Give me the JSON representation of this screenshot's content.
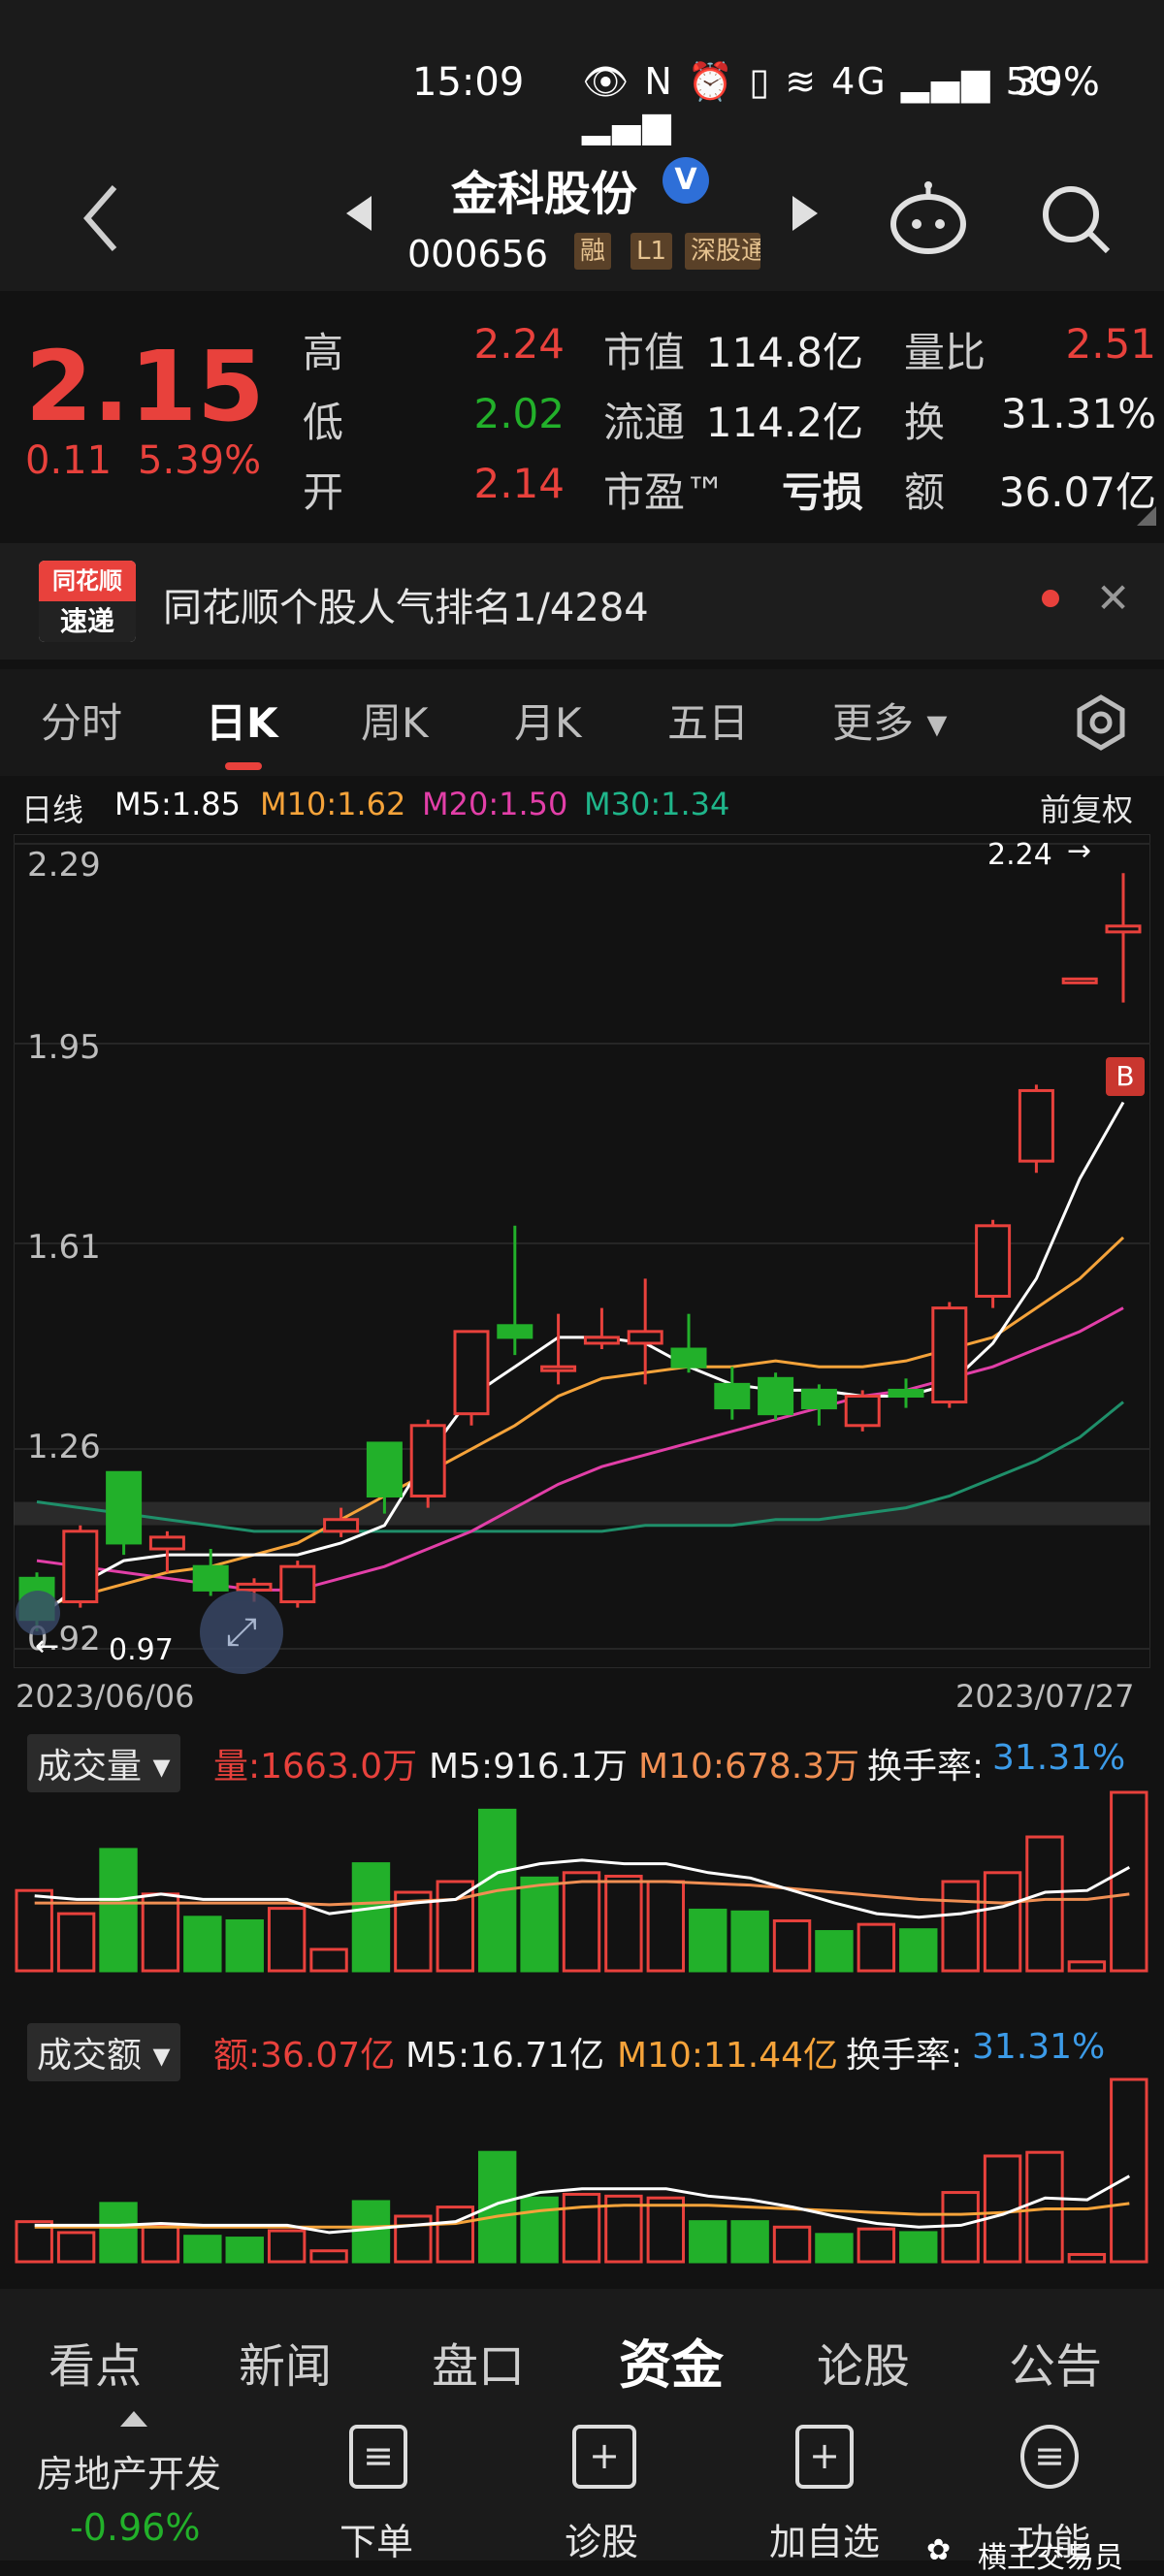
{
  "status_bar": {
    "time": "15:09",
    "icons": "👁 N ⏰ ▯ ≋ 4G ▂▄▆ 5G ▂▄▆",
    "battery": "39%"
  },
  "header": {
    "stock_name": "金科股份",
    "verified": "V",
    "code": "000656",
    "tags": [
      "融",
      "L1",
      "深股通"
    ]
  },
  "quote": {
    "price": "2.15",
    "change": "0.11",
    "change_pct": "5.39%",
    "high_label": "高",
    "high": "2.24",
    "low_label": "低",
    "low": "2.02",
    "open_label": "开",
    "open": "2.14",
    "mcap_label": "市值",
    "mcap": "114.8亿",
    "float_label": "流通",
    "float": "114.2亿",
    "pe_label": "市盈™",
    "pe": "亏损",
    "vr_label": "量比",
    "vr": "2.51",
    "turn_label": "换",
    "turn": "31.31%",
    "amt_label": "额",
    "amt": "36.07亿"
  },
  "banner": {
    "logo_top": "同花顺",
    "logo_bottom": "速递",
    "text": "同花顺个股人气排名1/4284"
  },
  "tabs": [
    "分时",
    "日K",
    "周K",
    "月K",
    "五日",
    "更多 ▾"
  ],
  "kline": {
    "legend_label": "日线",
    "m5": "M5:1.85",
    "m10": "M10:1.62",
    "m20": "M20:1.50",
    "m30": "M30:1.34",
    "adjust": "前复权",
    "max_marker": "2.24",
    "min_marker": "0.97",
    "buy_marker": "B",
    "y_ticks": [
      "2.29",
      "1.95",
      "1.61",
      "1.26",
      "0.92"
    ],
    "start_date": "2023/06/06",
    "end_date": "2023/07/27"
  },
  "volume_panel": {
    "title": "成交量",
    "value": "量:1663.0万",
    "m5": "M5:916.1万",
    "m10": "M10:678.3万",
    "turnover_label": "换手率:",
    "turnover": "31.31%"
  },
  "amount_panel": {
    "title": "成交额",
    "value": "额:36.07亿",
    "m5": "M5:16.71亿",
    "m10": "M10:11.44亿",
    "turnover_label": "换手率:",
    "turnover": "31.31%"
  },
  "colors": {
    "up": "#e8413c",
    "down": "#22b02a",
    "m5": "#ffffff",
    "m10": "#f5a33a",
    "m20": "#e23fa8",
    "m30": "#1f8f6a",
    "turnover": "#3c9be8"
  },
  "chart_data": [
    {
      "type": "candlestick",
      "title": "日线",
      "x_start": "2023/06/06",
      "x_end": "2023/07/27",
      "ylim": [
        0.92,
        2.29
      ],
      "candles": [
        {
          "o": 1.04,
          "c": 0.97,
          "h": 1.05,
          "l": 0.95
        },
        {
          "o": 1.0,
          "c": 1.12,
          "h": 1.13,
          "l": 0.99
        },
        {
          "o": 1.22,
          "c": 1.1,
          "h": 1.22,
          "l": 1.08
        },
        {
          "o": 1.09,
          "c": 1.11,
          "h": 1.12,
          "l": 1.05
        },
        {
          "o": 1.06,
          "c": 1.02,
          "h": 1.09,
          "l": 1.01
        },
        {
          "o": 1.02,
          "c": 1.03,
          "h": 1.04,
          "l": 1.0
        },
        {
          "o": 1.0,
          "c": 1.06,
          "h": 1.07,
          "l": 0.99
        },
        {
          "o": 1.12,
          "c": 1.14,
          "h": 1.16,
          "l": 1.11
        },
        {
          "o": 1.27,
          "c": 1.18,
          "h": 1.27,
          "l": 1.15
        },
        {
          "o": 1.18,
          "c": 1.3,
          "h": 1.31,
          "l": 1.16
        },
        {
          "o": 1.32,
          "c": 1.46,
          "h": 1.46,
          "l": 1.3
        },
        {
          "o": 1.47,
          "c": 1.45,
          "h": 1.64,
          "l": 1.42
        },
        {
          "o": 1.4,
          "c": 1.4,
          "h": 1.49,
          "l": 1.37
        },
        {
          "o": 1.44,
          "c": 1.45,
          "h": 1.5,
          "l": 1.43
        },
        {
          "o": 1.44,
          "c": 1.46,
          "h": 1.55,
          "l": 1.37
        },
        {
          "o": 1.43,
          "c": 1.4,
          "h": 1.49,
          "l": 1.39
        },
        {
          "o": 1.37,
          "c": 1.33,
          "h": 1.4,
          "l": 1.31
        },
        {
          "o": 1.38,
          "c": 1.32,
          "h": 1.39,
          "l": 1.31
        },
        {
          "o": 1.36,
          "c": 1.33,
          "h": 1.37,
          "l": 1.3
        },
        {
          "o": 1.3,
          "c": 1.35,
          "h": 1.36,
          "l": 1.29
        },
        {
          "o": 1.36,
          "c": 1.35,
          "h": 1.38,
          "l": 1.33
        },
        {
          "o": 1.34,
          "c": 1.5,
          "h": 1.51,
          "l": 1.33
        },
        {
          "o": 1.52,
          "c": 1.64,
          "h": 1.65,
          "l": 1.5
        },
        {
          "o": 1.75,
          "c": 1.87,
          "h": 1.88,
          "l": 1.73
        },
        {
          "o": 2.06,
          "c": 2.06,
          "h": 2.06,
          "l": 2.06
        },
        {
          "o": 2.14,
          "c": 2.15,
          "h": 2.24,
          "l": 2.02
        }
      ],
      "ma": {
        "M5": [
          0.97,
          1.03,
          1.07,
          1.08,
          1.08,
          1.08,
          1.08,
          1.1,
          1.13,
          1.25,
          1.35,
          1.4,
          1.45,
          1.45,
          1.44,
          1.4,
          1.37,
          1.36,
          1.36,
          1.35,
          1.35,
          1.37,
          1.44,
          1.55,
          1.72,
          1.85
        ],
        "M10": [
          0.99,
          1.01,
          1.03,
          1.05,
          1.06,
          1.08,
          1.1,
          1.14,
          1.18,
          1.22,
          1.26,
          1.3,
          1.35,
          1.38,
          1.39,
          1.4,
          1.4,
          1.41,
          1.4,
          1.4,
          1.41,
          1.43,
          1.45,
          1.5,
          1.55,
          1.62
        ],
        "M20": [
          1.07,
          1.06,
          1.05,
          1.04,
          1.03,
          1.02,
          1.02,
          1.04,
          1.06,
          1.09,
          1.12,
          1.16,
          1.2,
          1.23,
          1.25,
          1.27,
          1.29,
          1.31,
          1.33,
          1.35,
          1.36,
          1.38,
          1.4,
          1.43,
          1.46,
          1.5
        ],
        "M30": [
          1.17,
          1.16,
          1.15,
          1.14,
          1.13,
          1.12,
          1.12,
          1.12,
          1.12,
          1.12,
          1.12,
          1.12,
          1.12,
          1.12,
          1.13,
          1.13,
          1.13,
          1.14,
          1.14,
          1.15,
          1.16,
          1.18,
          1.21,
          1.24,
          1.28,
          1.34
        ]
      }
    },
    {
      "type": "bar",
      "title": "成交量",
      "values": [
        0.45,
        0.32,
        0.68,
        0.43,
        0.3,
        0.28,
        0.35,
        0.12,
        0.6,
        0.44,
        0.5,
        0.9,
        0.52,
        0.55,
        0.53,
        0.5,
        0.34,
        0.33,
        0.28,
        0.22,
        0.26,
        0.23,
        0.5,
        0.55,
        0.75,
        0.05,
        1.0
      ],
      "up": [
        true,
        true,
        false,
        true,
        false,
        false,
        true,
        true,
        false,
        true,
        true,
        false,
        false,
        true,
        true,
        true,
        false,
        false,
        true,
        false,
        true,
        false,
        true,
        true,
        true,
        true,
        true
      ],
      "M5": [
        0.42,
        0.4,
        0.4,
        0.43,
        0.4,
        0.4,
        0.4,
        0.32,
        0.35,
        0.38,
        0.4,
        0.55,
        0.6,
        0.62,
        0.6,
        0.6,
        0.55,
        0.52,
        0.45,
        0.38,
        0.32,
        0.3,
        0.32,
        0.36,
        0.44,
        0.45,
        0.58
      ],
      "M10": [
        0.38,
        0.38,
        0.38,
        0.38,
        0.38,
        0.38,
        0.38,
        0.37,
        0.38,
        0.39,
        0.4,
        0.45,
        0.48,
        0.5,
        0.5,
        0.5,
        0.49,
        0.48,
        0.46,
        0.44,
        0.42,
        0.4,
        0.39,
        0.38,
        0.4,
        0.4,
        0.43
      ]
    },
    {
      "type": "bar",
      "title": "成交额",
      "values": [
        0.22,
        0.16,
        0.32,
        0.2,
        0.14,
        0.13,
        0.17,
        0.06,
        0.33,
        0.25,
        0.3,
        0.6,
        0.35,
        0.37,
        0.36,
        0.35,
        0.22,
        0.22,
        0.19,
        0.15,
        0.18,
        0.16,
        0.38,
        0.58,
        0.6,
        0.04,
        1.0
      ],
      "up": [
        true,
        true,
        false,
        true,
        false,
        false,
        true,
        true,
        false,
        true,
        true,
        false,
        false,
        true,
        true,
        true,
        false,
        false,
        true,
        false,
        true,
        false,
        true,
        true,
        true,
        true,
        true
      ],
      "M5": [
        0.2,
        0.2,
        0.2,
        0.21,
        0.2,
        0.2,
        0.2,
        0.16,
        0.18,
        0.2,
        0.22,
        0.32,
        0.38,
        0.4,
        0.4,
        0.4,
        0.36,
        0.34,
        0.3,
        0.25,
        0.21,
        0.19,
        0.2,
        0.26,
        0.35,
        0.34,
        0.47
      ],
      "M10": [
        0.19,
        0.19,
        0.19,
        0.19,
        0.19,
        0.19,
        0.19,
        0.19,
        0.19,
        0.2,
        0.21,
        0.25,
        0.28,
        0.3,
        0.31,
        0.31,
        0.31,
        0.3,
        0.29,
        0.28,
        0.27,
        0.26,
        0.26,
        0.27,
        0.29,
        0.29,
        0.32
      ]
    }
  ],
  "bottom_tabs": [
    "看点",
    "新闻",
    "盘口",
    "资金",
    "论股",
    "公告"
  ],
  "toolbar": {
    "sector_name": "房地产开发",
    "sector_change": "-0.96%",
    "buttons": [
      "下单",
      "诊股",
      "加自选",
      "功能"
    ],
    "watermark": "横王交易员"
  }
}
